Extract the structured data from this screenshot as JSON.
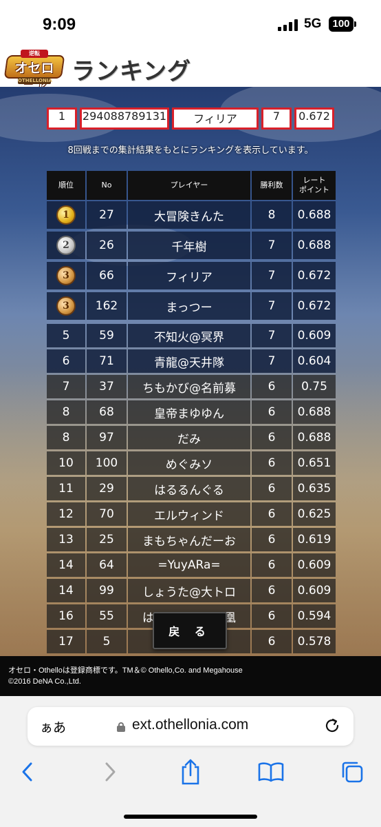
{
  "status_bar": {
    "time": "9:09",
    "network": "5G",
    "battery": "100"
  },
  "header": {
    "title": "ランキング",
    "logo_top": "逆転",
    "logo_main": "オセロニア",
    "logo_sub": "OTHELLONIA"
  },
  "filter": {
    "rank": "1",
    "player_id": "294088789131",
    "player_name": "フィリア",
    "wins": "7",
    "rate": "0.672"
  },
  "note": "8回戦までの集計結果をもとにランキングを表示しています。",
  "table": {
    "headers": {
      "rank": "順位",
      "no": "No",
      "player": "プレイヤー",
      "wins": "勝利数",
      "rate_line1": "レート",
      "rate_line2": "ポイント"
    },
    "rows": [
      {
        "rank": "1",
        "no": "27",
        "player": "大冒険きんた",
        "wins": "8",
        "rate": "0.688"
      },
      {
        "rank": "2",
        "no": "26",
        "player": "千年樹",
        "wins": "7",
        "rate": "0.688"
      },
      {
        "rank": "3",
        "no": "66",
        "player": "フィリア",
        "wins": "7",
        "rate": "0.672"
      },
      {
        "rank": "3",
        "no": "162",
        "player": "まっつー",
        "wins": "7",
        "rate": "0.672"
      },
      {
        "rank": "5",
        "no": "59",
        "player": "不知火@冥界",
        "wins": "7",
        "rate": "0.609"
      },
      {
        "rank": "6",
        "no": "71",
        "player": "青龍@天井隊",
        "wins": "7",
        "rate": "0.604"
      },
      {
        "rank": "7",
        "no": "37",
        "player": "ちもかび@名前募",
        "wins": "6",
        "rate": "0.75"
      },
      {
        "rank": "8",
        "no": "68",
        "player": "皇帝まゆゆん",
        "wins": "6",
        "rate": "0.688"
      },
      {
        "rank": "8",
        "no": "97",
        "player": "だみ",
        "wins": "6",
        "rate": "0.688"
      },
      {
        "rank": "10",
        "no": "100",
        "player": "めぐみソ",
        "wins": "6",
        "rate": "0.651"
      },
      {
        "rank": "11",
        "no": "29",
        "player": "はるるんぐる",
        "wins": "6",
        "rate": "0.635"
      },
      {
        "rank": "12",
        "no": "70",
        "player": "エルウィンド",
        "wins": "6",
        "rate": "0.625"
      },
      {
        "rank": "13",
        "no": "25",
        "player": "まもちゃんだーお",
        "wins": "6",
        "rate": "0.619"
      },
      {
        "rank": "14",
        "no": "64",
        "player": "=YuyARa=",
        "wins": "6",
        "rate": "0.609"
      },
      {
        "rank": "14",
        "no": "99",
        "player": "しょうた@大トロ",
        "wins": "6",
        "rate": "0.609"
      },
      {
        "rank": "16",
        "no": "55",
        "player": "はな　　まの風凰",
        "wins": "6",
        "rate": "0.594"
      },
      {
        "rank": "17",
        "no": "5",
        "player": "",
        "wins": "6",
        "rate": "0.578"
      }
    ]
  },
  "back_button": "戻 る",
  "footer": {
    "line1": "オセロ・Othelloは登録商標です。TM＆© Othello,Co. and Megahouse",
    "line2": "©2016 DeNA Co.,Ltd."
  },
  "browser": {
    "aa": "ぁあ",
    "url": "ext.othellonia.com"
  },
  "icons": {
    "back": "chevron-left-icon",
    "forward": "chevron-right-icon",
    "share": "share-icon",
    "bookmarks": "book-icon",
    "tabs": "tabs-icon",
    "reload": "reload-icon",
    "lock": "lock-icon"
  },
  "colors": {
    "accent": "#d8202a",
    "ios_blue": "#1a73e8"
  }
}
